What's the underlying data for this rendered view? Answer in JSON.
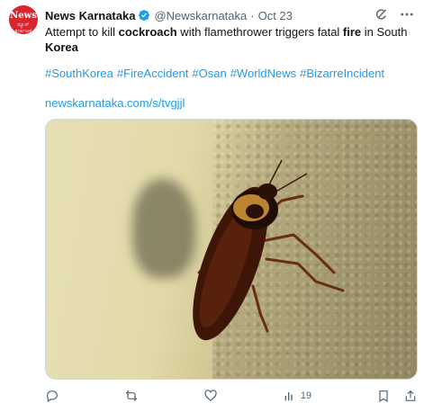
{
  "account": {
    "display_name": "News Karnataka",
    "handle": "@Newskarnataka",
    "date": "Oct 23",
    "avatar_text_top": "News",
    "avatar_text_bottom": "ನ್ಯೂಸ್ ಕರ್ನಾಟಕ",
    "verified_color": "#1d9bf0",
    "avatar_color": "#d7262e"
  },
  "tweet": {
    "text_part1": "Attempt to kill ",
    "text_bold1": "cockroach",
    "text_part2": " with flamethrower triggers fatal ",
    "text_bold2": "fire",
    "text_part3": " in South ",
    "text_bold3": "Korea",
    "hashtags": [
      "#SouthKorea",
      "#FireAccident",
      "#Osan",
      "#WorldNews",
      "#BizarreIncident"
    ],
    "link": "newskarnataka.com/s/tvgjjl",
    "link_color": "#1d9bf0"
  },
  "media": {
    "subject": "cockroach on textured wall photo"
  },
  "actions": {
    "views_count": "19"
  },
  "icons": {
    "top": [
      "grok-icon",
      "more-icon"
    ],
    "bottom": [
      "reply-icon",
      "retweet-icon",
      "like-icon",
      "views-icon",
      "bookmark-icon",
      "share-icon"
    ]
  }
}
